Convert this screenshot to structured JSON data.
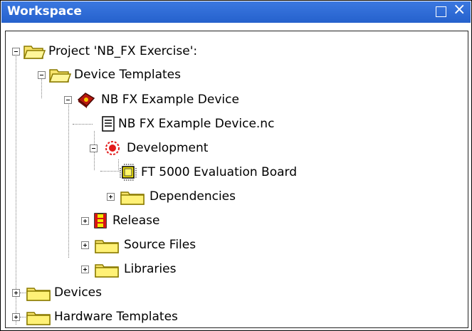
{
  "window": {
    "title": "Workspace",
    "maximize_glyph": "□",
    "close_glyph": "×"
  },
  "tree": {
    "project": "Project 'NB_FX Exercise':",
    "device_templates": "Device Templates",
    "example_device": "NB FX Example Device",
    "nc_file": "NB FX Example Device.nc",
    "development": "Development",
    "eval_board": "FT 5000 Evaluation Board",
    "dependencies": "Dependencies",
    "release": "Release",
    "source_files": "Source Files",
    "libraries": "Libraries",
    "devices": "Devices",
    "hardware_templates": "Hardware Templates"
  },
  "icons": {
    "folder": "folder-icon",
    "open_folder": "open-folder-icon",
    "device": "device-icon",
    "file": "document-icon",
    "target": "target-icon",
    "chip": "chip-icon",
    "release": "release-icon"
  },
  "colors": {
    "titlebar": "#2b69d3",
    "folder": "#f7e36b",
    "folder_edge": "#8a7a00"
  }
}
